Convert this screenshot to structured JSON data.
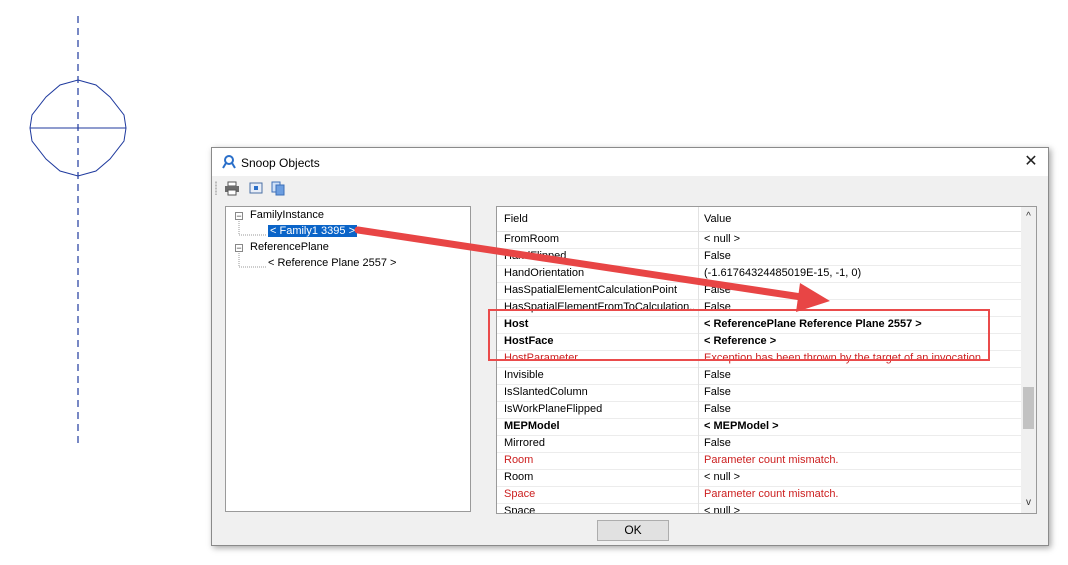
{
  "window": {
    "title": "Snoop Objects",
    "close_label": "✕",
    "ok_label": "OK"
  },
  "toolbar": {
    "buttons": [
      "print-icon",
      "snoop-icon",
      "copy-icon"
    ]
  },
  "tree": {
    "nodes": [
      {
        "label": "FamilyInstance",
        "expander": "−"
      },
      {
        "label": "< Family1  3395 >",
        "selected": true
      },
      {
        "label": "ReferencePlane",
        "expander": "−"
      },
      {
        "label": "< Reference Plane  2557 >"
      }
    ]
  },
  "grid": {
    "header": {
      "field": "Field",
      "value": "Value"
    },
    "scroll_up": "^",
    "scroll_down": "v",
    "rows": [
      {
        "field": "FromRoom",
        "value": "< null >",
        "style": "normal"
      },
      {
        "field": "HandFlipped",
        "value": "False",
        "style": "normal"
      },
      {
        "field": "HandOrientation",
        "value": "(-1.61764324485019E-15, -1, 0)",
        "style": "normal"
      },
      {
        "field": "HasSpatialElementCalculationPoint",
        "value": "False",
        "style": "normal"
      },
      {
        "field": "HasSpatialElementFromToCalculation...",
        "value": "False",
        "style": "normal"
      },
      {
        "field": "Host",
        "value": "< ReferencePlane  Reference Plane  2557 >",
        "style": "bold"
      },
      {
        "field": "HostFace",
        "value": "< Reference >",
        "style": "bold"
      },
      {
        "field": "HostParameter",
        "value": "Exception has been thrown by the target of an invocation.",
        "style": "red"
      },
      {
        "field": "Invisible",
        "value": "False",
        "style": "normal"
      },
      {
        "field": "IsSlantedColumn",
        "value": "False",
        "style": "normal"
      },
      {
        "field": "IsWorkPlaneFlipped",
        "value": "False",
        "style": "normal"
      },
      {
        "field": "MEPModel",
        "value": "< MEPModel >",
        "style": "bold"
      },
      {
        "field": "Mirrored",
        "value": "False",
        "style": "normal"
      },
      {
        "field": "Room",
        "value": "Parameter count mismatch.",
        "style": "red"
      },
      {
        "field": "Room",
        "value": "< null >",
        "style": "normal"
      },
      {
        "field": "Space",
        "value": "Parameter count mismatch.",
        "style": "red"
      },
      {
        "field": "Space",
        "value": "< null >",
        "style": "normal"
      }
    ]
  },
  "annotation": {
    "arrow_color": "#e84545",
    "box_color": "#ea4b4b"
  },
  "drawing": {
    "line_color": "#1f3a9e"
  }
}
